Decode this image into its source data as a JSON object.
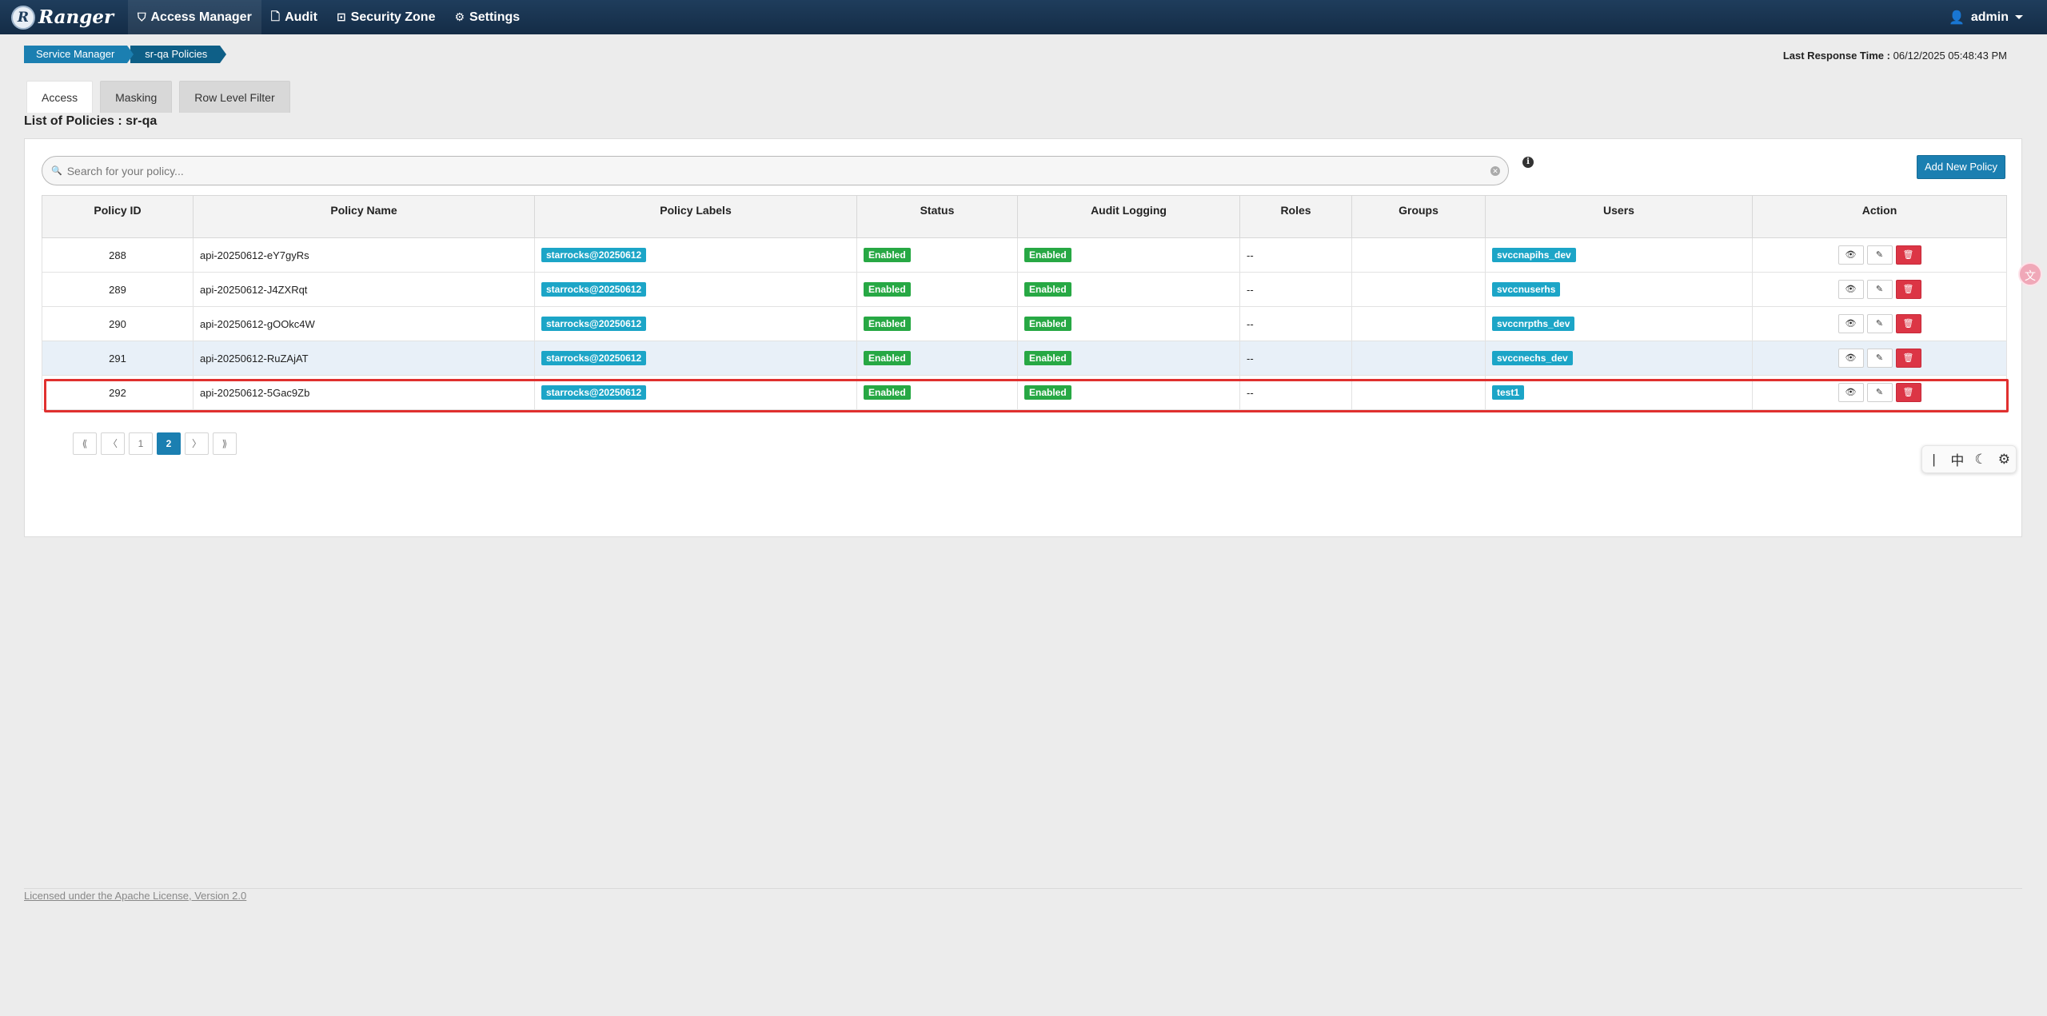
{
  "navbar": {
    "brand_letter": "R",
    "brand_name": "Ranger",
    "items": [
      {
        "label": "Access Manager",
        "icon": "shield-icon"
      },
      {
        "label": "Audit",
        "icon": "file-icon"
      },
      {
        "label": "Security Zone",
        "icon": "zone-icon"
      },
      {
        "label": "Settings",
        "icon": "gear-icon"
      }
    ],
    "user": "admin"
  },
  "breadcrumb": [
    "Service Manager",
    "sr-qa Policies"
  ],
  "last_response": {
    "label": "Last Response Time :",
    "value": "06/12/2025 05:48:43 PM"
  },
  "tabs": [
    "Access",
    "Masking",
    "Row Level Filter"
  ],
  "list_title": "List of Policies : sr-qa",
  "search": {
    "placeholder": "Search for your policy..."
  },
  "add_button": "Add New Policy",
  "table": {
    "headers": [
      "Policy ID",
      "Policy Name",
      "Policy Labels",
      "Status",
      "Audit Logging",
      "Roles",
      "Groups",
      "Users",
      "Action"
    ],
    "rows": [
      {
        "id": "288",
        "name": "api-20250612-eY7gyRs",
        "label": "starrocks@20250612",
        "status": "Enabled",
        "audit": "Enabled",
        "roles": "--",
        "groups": "",
        "users": "svccnapihs_dev"
      },
      {
        "id": "289",
        "name": "api-20250612-J4ZXRqt",
        "label": "starrocks@20250612",
        "status": "Enabled",
        "audit": "Enabled",
        "roles": "--",
        "groups": "",
        "users": "svccnuserhs"
      },
      {
        "id": "290",
        "name": "api-20250612-gOOkc4W",
        "label": "starrocks@20250612",
        "status": "Enabled",
        "audit": "Enabled",
        "roles": "--",
        "groups": "",
        "users": "svccnrpths_dev"
      },
      {
        "id": "291",
        "name": "api-20250612-RuZAjAT",
        "label": "starrocks@20250612",
        "status": "Enabled",
        "audit": "Enabled",
        "roles": "--",
        "groups": "",
        "users": "svccnechs_dev"
      },
      {
        "id": "292",
        "name": "api-20250612-5Gac9Zb",
        "label": "starrocks@20250612",
        "status": "Enabled",
        "audit": "Enabled",
        "roles": "--",
        "groups": "",
        "users": "test1"
      }
    ]
  },
  "pagination": {
    "first": "⟪",
    "prev": "〈",
    "pages": [
      "1",
      "2"
    ],
    "current": "2",
    "next": "〉",
    "last": "⟫"
  },
  "ime_toolbar": [
    "|",
    "中",
    "☾",
    "⚙"
  ],
  "footer": "Licensed under the Apache License, Version 2.0",
  "colors": {
    "navbar": "#1f3d5c",
    "primary": "#1b7fb1",
    "label_badge": "#1ca5c7",
    "enabled_badge": "#27a844",
    "delete": "#dc3545",
    "highlight": "#e0302f"
  }
}
